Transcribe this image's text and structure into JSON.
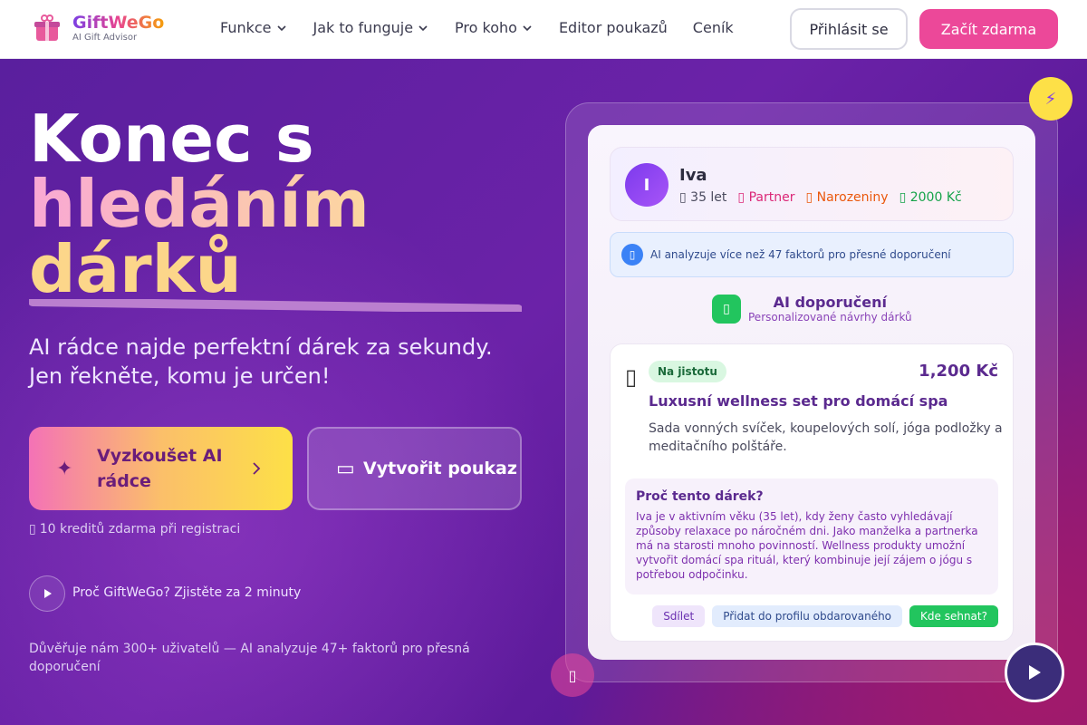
{
  "brand": {
    "name": "GiftWeGo",
    "tagline": "AI Gift Advisor"
  },
  "nav": {
    "items": [
      {
        "label": "Funkce",
        "dropdown": true
      },
      {
        "label": "Jak to funguje",
        "dropdown": true
      },
      {
        "label": "Pro koho",
        "dropdown": true
      },
      {
        "label": "Editor poukazů",
        "dropdown": false
      },
      {
        "label": "Ceník",
        "dropdown": false
      }
    ],
    "login_label": "Přihlásit se",
    "start_label": "Začít zdarma"
  },
  "hero": {
    "title_line1": "Konec s",
    "title_line2": "hledáním",
    "title_line3": "dárků",
    "subtitle": "AI rádce najde perfektní dárek za sekundy. Jen řekněte, komu je určen!",
    "cta_primary": "Vyzkoušet AI rádce",
    "cta_secondary": "Vytvořit poukaz",
    "credits": "10 kreditů zdarma při registraci",
    "why_link": "Proč GiftWeGo? Zjistěte za 2 minuty",
    "trust": "Důvěřuje nám 300+ uživatelů — AI analyzuje 47+ faktorů pro přesná doporučení"
  },
  "card": {
    "profile": {
      "initial": "I",
      "name": "Iva",
      "age": "35 let",
      "relation": "Partner",
      "occasion": "Narozeniny",
      "budget": "2000 Kč"
    },
    "info": "AI analyzuje více než 47 faktorů pro přesné doporučení",
    "rec_title": "AI doporučení",
    "rec_subtitle": "Personalizované návrhy dárků",
    "gift": {
      "badge": "Na jistotu",
      "price": "1,200 Kč",
      "title": "Luxusní wellness set pro domácí spa",
      "description": "Sada vonných svíček, koupelových solí, jóga podložky a meditačního polštáře.",
      "why_title": "Proč tento dárek?",
      "why_text": "Iva je v aktivním věku (35 let), kdy ženy často vyhledávají způsoby relaxace po náročném dni. Jako manželka a partnerka má na starosti mnoho povinností. Wellness produkty umožní vytvořit domácí spa rituál, který kombinuje její zájem o jógu s potřebou odpočinku.",
      "share_label": "Sdílet",
      "add_label": "Přidat do profilu obdarovaného",
      "where_label": "Kde sehnat?"
    }
  },
  "colors": {
    "accent": "#ec4899",
    "purple": "#5b2a8f",
    "green": "#22c55e",
    "yellow": "#fde047"
  }
}
